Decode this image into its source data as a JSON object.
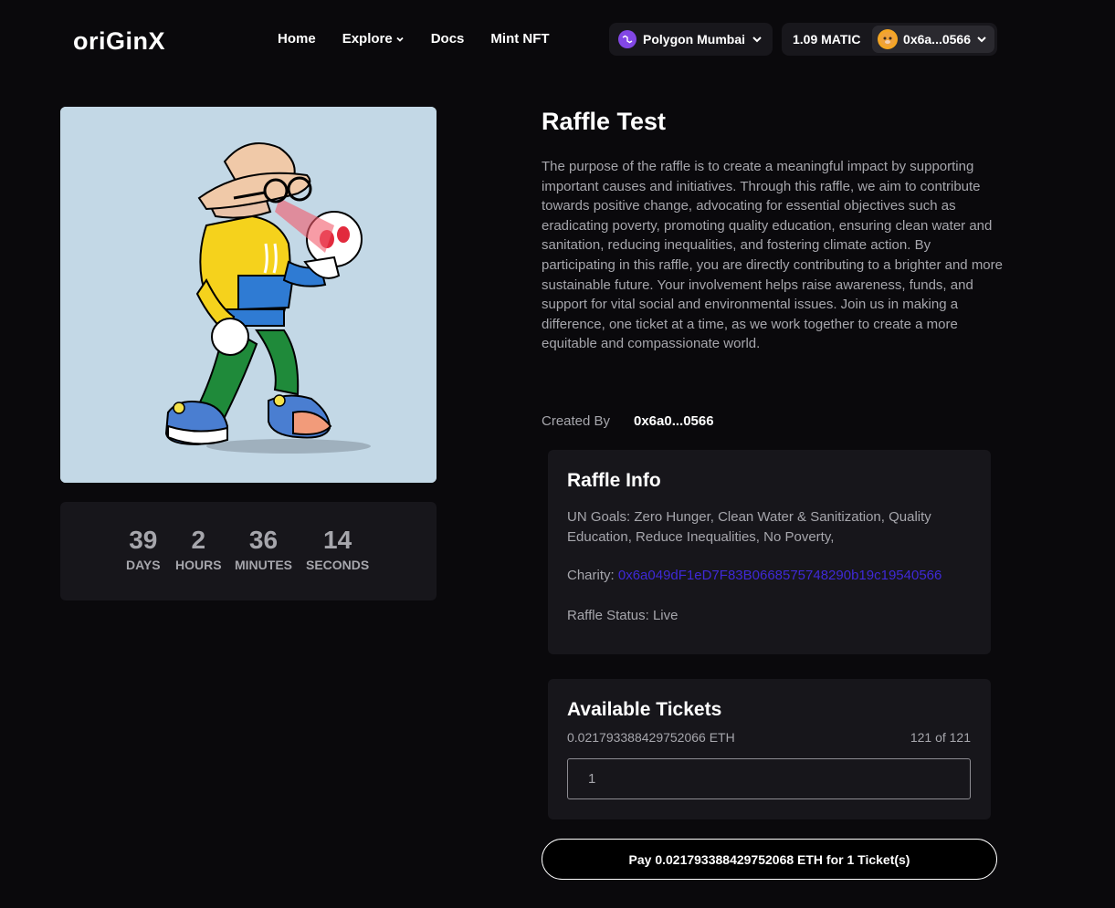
{
  "nav": {
    "logo": "oriGinX",
    "links": [
      "Home",
      "Explore",
      "Docs",
      "Mint NFT"
    ],
    "network": "Polygon Mumbai",
    "balance": "1.09 MATIC",
    "account": "0x6a...0566"
  },
  "countdown": {
    "days": "39",
    "days_label": "DAYS",
    "hours": "2",
    "hours_label": "HOURS",
    "minutes": "36",
    "minutes_label": "MINUTES",
    "seconds": "14",
    "seconds_label": "SECONDS"
  },
  "raffle": {
    "title": "Raffle Test",
    "description": "The purpose of the raffle is to create a meaningful impact by supporting important causes and initiatives. Through this raffle, we aim to contribute towards positive change, advocating for essential objectives such as eradicating poverty, promoting quality education, ensuring clean water and sanitation, reducing inequalities, and fostering climate action. By participating in this raffle, you are directly contributing to a brighter and more sustainable future. Your involvement helps raise awareness, funds, and support for vital social and environmental issues. Join us in making a difference, one ticket at a time, as we work together to create a more equitable and compassionate world.",
    "created_by_label": "Created By",
    "created_by": "0x6a0...0566"
  },
  "info": {
    "title": "Raffle Info",
    "un_goals": "UN Goals: Zero Hunger, Clean Water & Sanitization, Quality Education, Reduce Inequalities, No Poverty,",
    "charity_label": "Charity: ",
    "charity_address": "0x6a049dF1eD7F83B0668575748290b19c19540566",
    "status": "Raffle Status: Live"
  },
  "tickets": {
    "title": "Available Tickets",
    "price": "0.021793388429752066 ETH",
    "count": "121 of 121",
    "quantity": "1"
  },
  "pay_button": "Pay 0.021793388429752068 ETH for 1 Ticket(s)",
  "colors": {
    "background": "#0a090c",
    "card": "#17161b",
    "link": "#3f29d6",
    "polygon": "#8247e5"
  }
}
